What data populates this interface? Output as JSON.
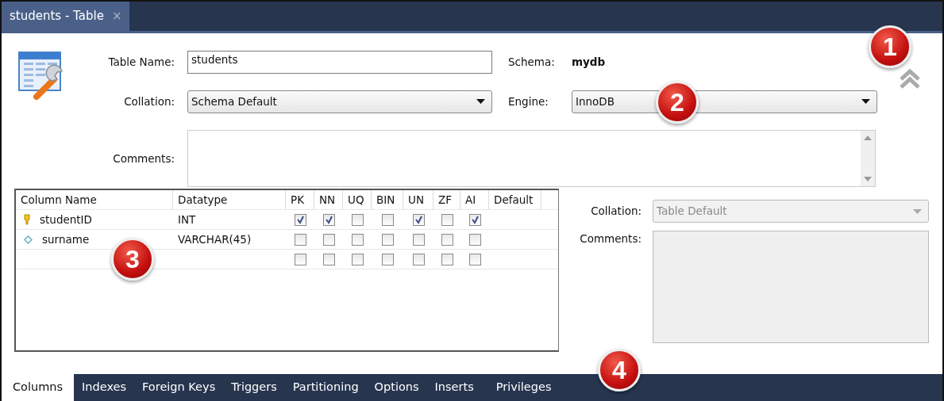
{
  "tab": {
    "title": "students - Table",
    "close": "×"
  },
  "form": {
    "table_name_label": "Table Name:",
    "table_name": "students",
    "schema_label": "Schema:",
    "schema": "mydb",
    "collation_label": "Collation:",
    "collation": "Schema Default",
    "engine_label": "Engine:",
    "engine": "InnoDB",
    "comments_label": "Comments:"
  },
  "columns_grid": {
    "headers": [
      "Column Name",
      "Datatype",
      "PK",
      "NN",
      "UQ",
      "BIN",
      "UN",
      "ZF",
      "AI",
      "Default"
    ],
    "rows": [
      {
        "kind": "primary-key",
        "name": "studentID",
        "datatype": "INT",
        "flags": [
          true,
          true,
          false,
          false,
          true,
          false,
          true
        ]
      },
      {
        "kind": "column",
        "name": "surname",
        "datatype": "VARCHAR(45)",
        "flags": [
          false,
          false,
          false,
          false,
          false,
          false,
          false
        ]
      },
      {
        "kind": "new",
        "flags": [
          false,
          false,
          false,
          false,
          false,
          false,
          false
        ]
      }
    ]
  },
  "column_details": {
    "collation_label": "Collation:",
    "collation": "Table Default",
    "collation_disabled": true,
    "comments_label": "Comments:",
    "comments_disabled": true
  },
  "bottom_tabs": [
    {
      "label": "Columns",
      "selected": true
    },
    {
      "label": "Indexes",
      "selected": false
    },
    {
      "label": "Foreign Keys",
      "selected": false
    },
    {
      "label": "Triggers",
      "selected": false
    },
    {
      "label": "Partitioning",
      "selected": false
    },
    {
      "label": "Options",
      "selected": false
    },
    {
      "label": "Inserts",
      "selected": false
    },
    {
      "label": "Privileges",
      "selected": false
    }
  ],
  "callouts": [
    {
      "number": "1"
    },
    {
      "number": "2"
    },
    {
      "number": "3"
    },
    {
      "number": "4"
    }
  ]
}
